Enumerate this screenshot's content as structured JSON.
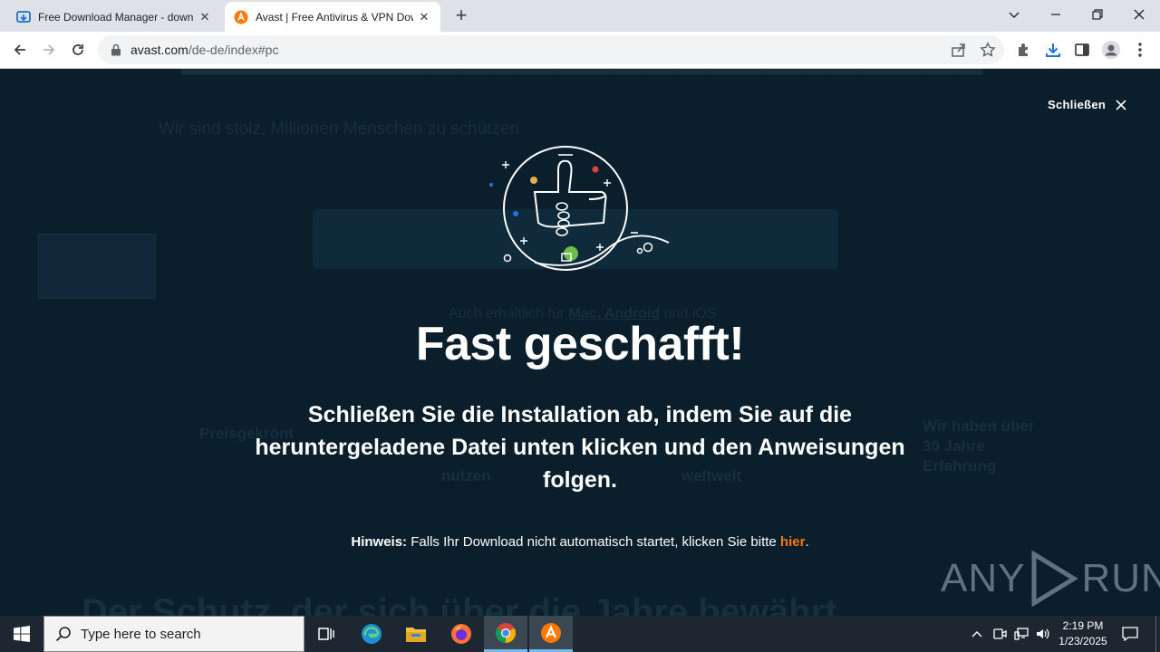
{
  "browser": {
    "tabs": [
      {
        "title": "Free Download Manager - down",
        "active": false,
        "favicon": "fdm-icon"
      },
      {
        "title": "Avast | Free Antivirus & VPN Dow",
        "active": true,
        "favicon": "avast-icon"
      }
    ],
    "url_host": "avast.com",
    "url_path": "/de-de/index#pc"
  },
  "background_page": {
    "heading": "Der Schutz, der sich über die Jahre bewährt",
    "line1": "Wir sind stolz, Millionen Menschen zu schützen",
    "also_label": "Auch erhältlich für",
    "also_link": "Mac, Android",
    "also_suffix": "und iOS",
    "col1": "Preisgekrönt",
    "col2": "nutzen",
    "col3": "weltweit",
    "col4": "Wir haben über 30 Jahre Erfahrung"
  },
  "overlay": {
    "close_label": "Schließen",
    "headline": "Fast geschafft!",
    "subtext": "Schließen Sie die Installation ab, indem Sie auf die heruntergeladene Datei unten klicken und den Anweisungen folgen.",
    "hint_label": "Hinweis:",
    "hint_text": " Falls Ihr Download nicht automatisch startet, klicken Sie bitte ",
    "hint_link": "hier",
    "hint_end": "."
  },
  "watermark": {
    "left": "ANY",
    "right": "RUN"
  },
  "taskbar": {
    "search_placeholder": "Type here to search",
    "time": "2:19 PM",
    "date": "1/23/2025",
    "apps": [
      "task-view-icon",
      "edge-icon",
      "file-explorer-icon",
      "firefox-icon",
      "chrome-icon",
      "avast-icon"
    ]
  },
  "colors": {
    "overlay_bg": "#0a1e2b",
    "accent_orange": "#ff7800"
  }
}
